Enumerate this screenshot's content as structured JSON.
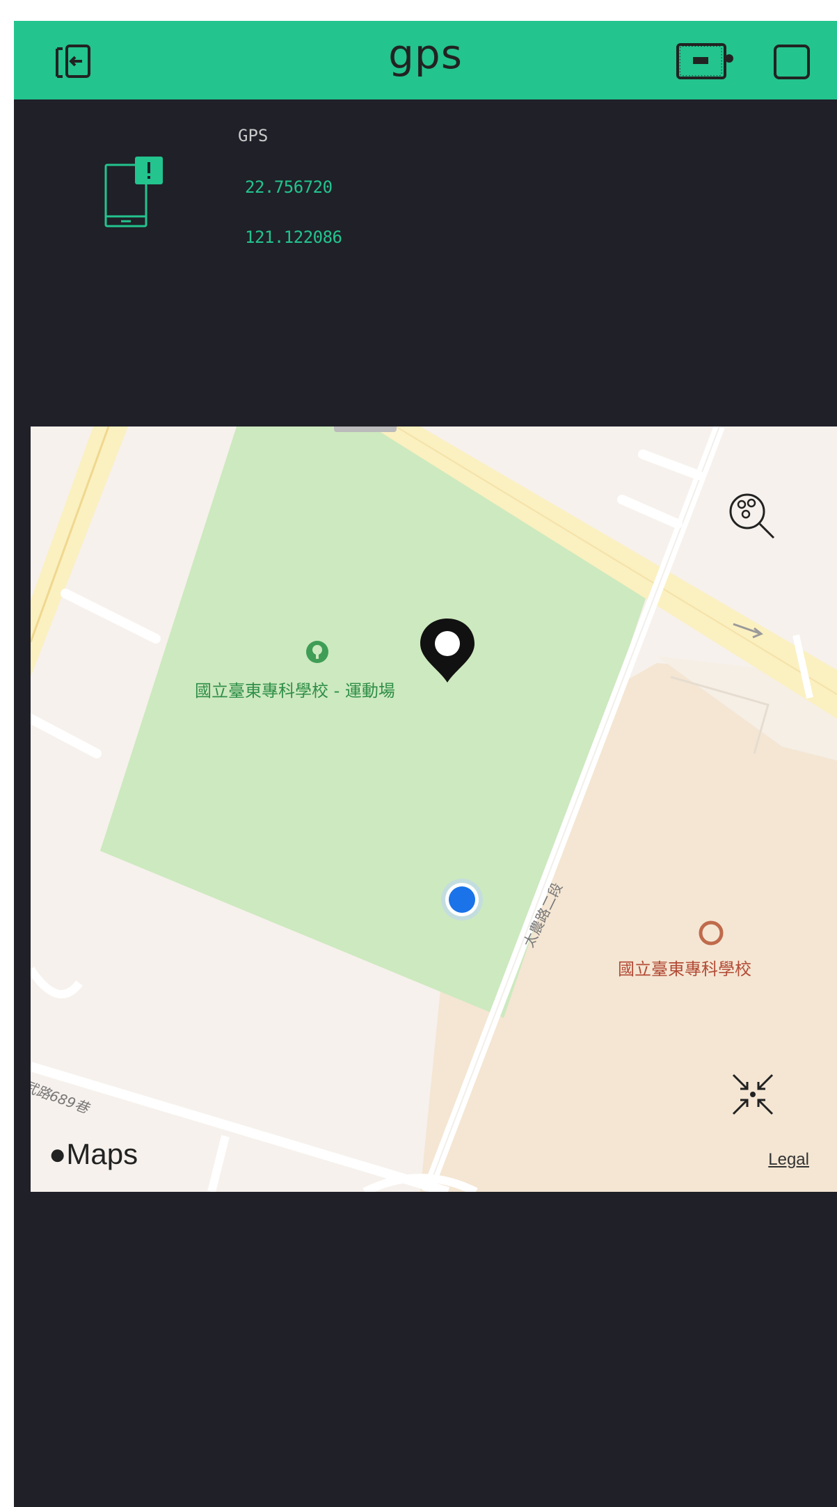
{
  "header": {
    "title": "gps",
    "exit_icon": "exit-icon",
    "device_icon": "device-status-icon",
    "settings_icon": "square-icon"
  },
  "gps_widget": {
    "icon": "phone-notification-icon",
    "label": "GPS",
    "latitude": "22.756720",
    "longitude": "121.122086"
  },
  "map": {
    "park_label": "國立臺東專科學校 - 運動場",
    "campus_label": "國立臺東專科學校",
    "road_label_1": "太農路二段",
    "road_label_2": "武路689巷",
    "logo_text": "Maps",
    "legal_link": "Legal",
    "search_poi_icon": "search-places-icon",
    "recenter_icon": "recenter-icon",
    "marker_icon": "map-pin-icon",
    "user_location_icon": "user-location-icon"
  },
  "colors": {
    "header_bg": "#23c48e",
    "app_bg": "#1f2028",
    "accent": "#23c48e",
    "park_green": "#cde9bf",
    "campus_tan": "#f4e6d3",
    "road_yellow": "#fbf0c0",
    "user_dot": "#1a73e8"
  }
}
